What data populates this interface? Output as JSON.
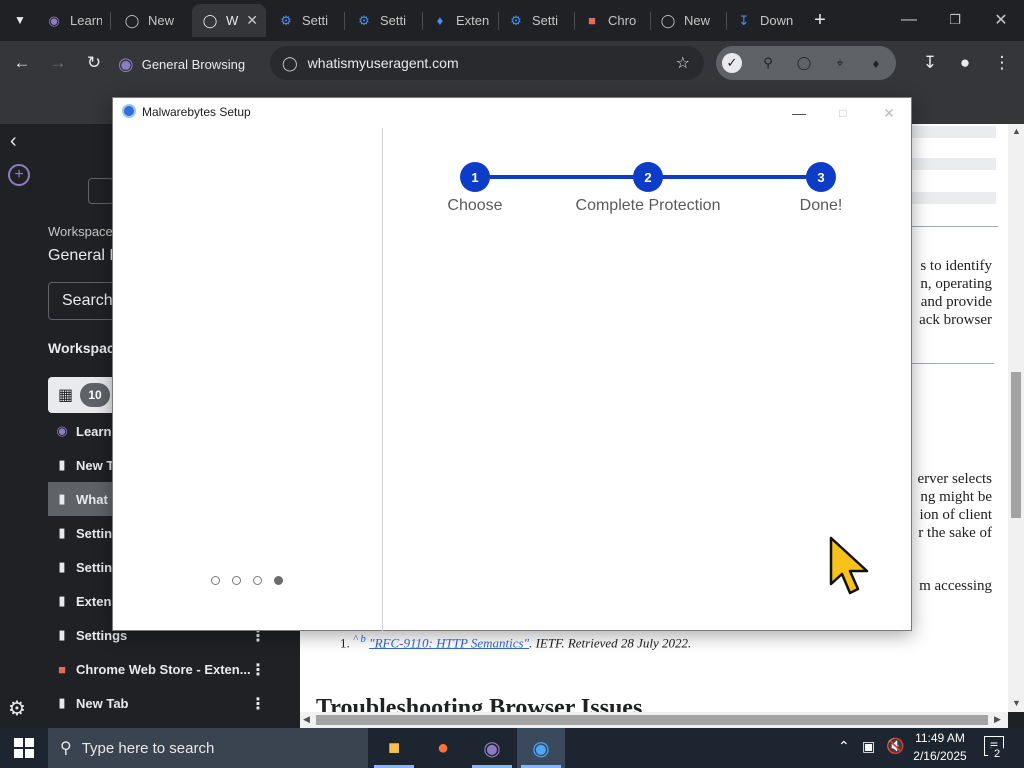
{
  "browser": {
    "tabs": [
      {
        "label": "Learn",
        "icon": "ghost-profile-icon"
      },
      {
        "label": "New",
        "icon": "ghost-icon"
      },
      {
        "label": "W",
        "icon": "globe-icon",
        "active": true
      },
      {
        "label": "Setti",
        "icon": "gear-icon"
      },
      {
        "label": "Setti",
        "icon": "gear-icon"
      },
      {
        "label": "Exten",
        "icon": "puzzle-icon"
      },
      {
        "label": "Setti",
        "icon": "gear-icon"
      },
      {
        "label": "Chro",
        "icon": "chrome-web-store-icon"
      },
      {
        "label": "New",
        "icon": "ghost-icon"
      },
      {
        "label": "Down",
        "icon": "download-icon"
      }
    ],
    "profile_name": "General Browsing",
    "url": "whatismyuseragent.com"
  },
  "side_panel": {
    "workspace_label": "Workspace",
    "workspace_name": "General B",
    "search_placeholder": "Search",
    "workspaces_heading": "Workspac",
    "tab_count": "10",
    "items": [
      {
        "label": "Learn",
        "icon": "ghost-profile-icon"
      },
      {
        "label": "New T",
        "icon": "page-icon"
      },
      {
        "label": "What i",
        "icon": "page-icon",
        "selected": true
      },
      {
        "label": "Settin",
        "icon": "page-icon"
      },
      {
        "label": "Settin",
        "icon": "page-icon"
      },
      {
        "label": "Extens",
        "icon": "page-icon"
      },
      {
        "label": "Settings",
        "icon": "page-icon"
      },
      {
        "label": "Chrome Web Store - Exten...",
        "icon": "chrome-web-store-icon"
      },
      {
        "label": "New Tab",
        "icon": "page-icon"
      }
    ]
  },
  "webpage": {
    "para1": [
      "s to identify",
      "n, operating",
      "and provide",
      "ack browser"
    ],
    "para2": [
      "erver selects",
      "ng might be",
      "ion of client",
      "r the sake of"
    ],
    "para3": "m accessing",
    "ref_number": "1.",
    "ref_carets": "^ b",
    "ref_link": "\"RFC-9110: HTTP Semantics\"",
    "ref_rest": ". IETF. Retrieved 28 July 2022.",
    "heading": "Troubleshooting Browser Issues"
  },
  "dialog": {
    "title": "Malwarebytes Setup",
    "steps": [
      {
        "number": "1",
        "label": "Choose"
      },
      {
        "number": "2",
        "label": "Complete Protection"
      },
      {
        "number": "3",
        "label": "Done!"
      }
    ],
    "page_dots_total": 4,
    "page_dots_active": 4
  },
  "taskbar": {
    "search_placeholder": "Type here to search",
    "time": "11:49 AM",
    "date": "2/16/2025",
    "notification_count": "2"
  },
  "colors": {
    "step_accent": "#0d3cc8",
    "browser_dark": "#202124",
    "toolbar": "#35363a"
  }
}
